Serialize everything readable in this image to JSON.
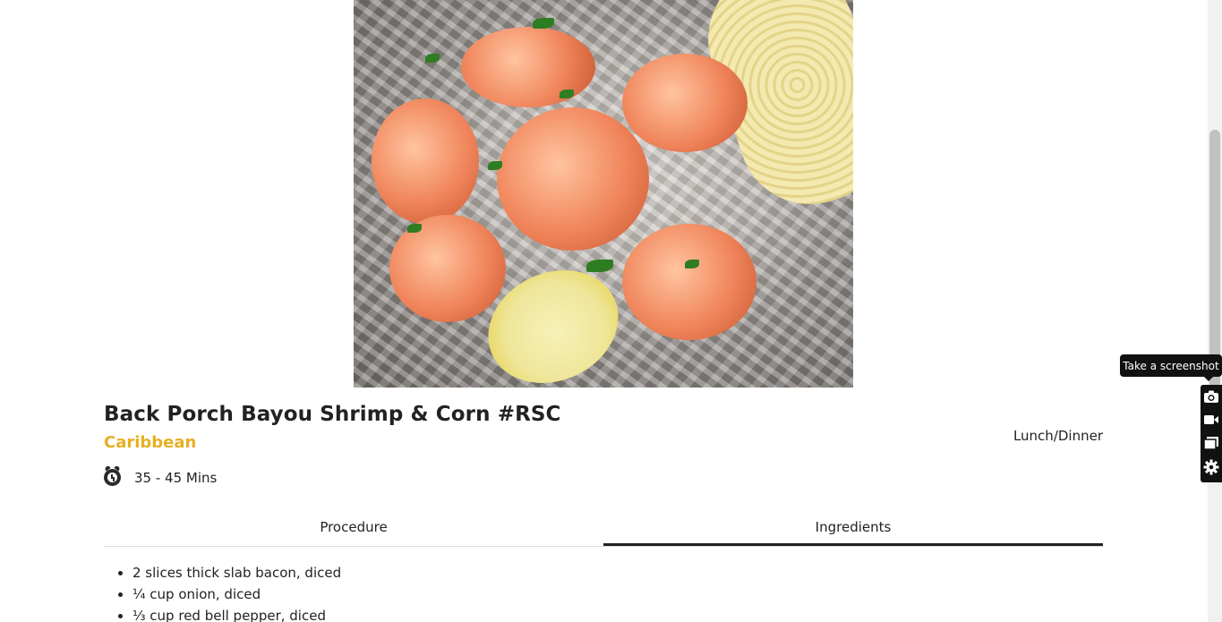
{
  "recipe": {
    "title": "Back Porch Bayou Shrimp & Corn #RSC",
    "cuisine": "Caribbean",
    "meal_type": "Lunch/Dinner",
    "time": "35 - 45 Mins",
    "time_icon": "alarm-clock-icon",
    "photo_icon": "recipe-photo"
  },
  "tabs": [
    {
      "label": "Procedure",
      "active": false
    },
    {
      "label": "Ingredients",
      "active": true
    }
  ],
  "ingredients": [
    "2 slices thick slab bacon, diced",
    "¼ cup onion, diced",
    "⅓ cup red bell pepper, diced"
  ],
  "overlay": {
    "tooltip": "Take a screenshot",
    "tools": [
      "camera-icon",
      "video-camera-icon",
      "window-icon",
      "gear-icon"
    ]
  },
  "colors": {
    "cuisine_accent": "#e7b021",
    "text": "#222222",
    "tab_active_underline": "#222222"
  }
}
